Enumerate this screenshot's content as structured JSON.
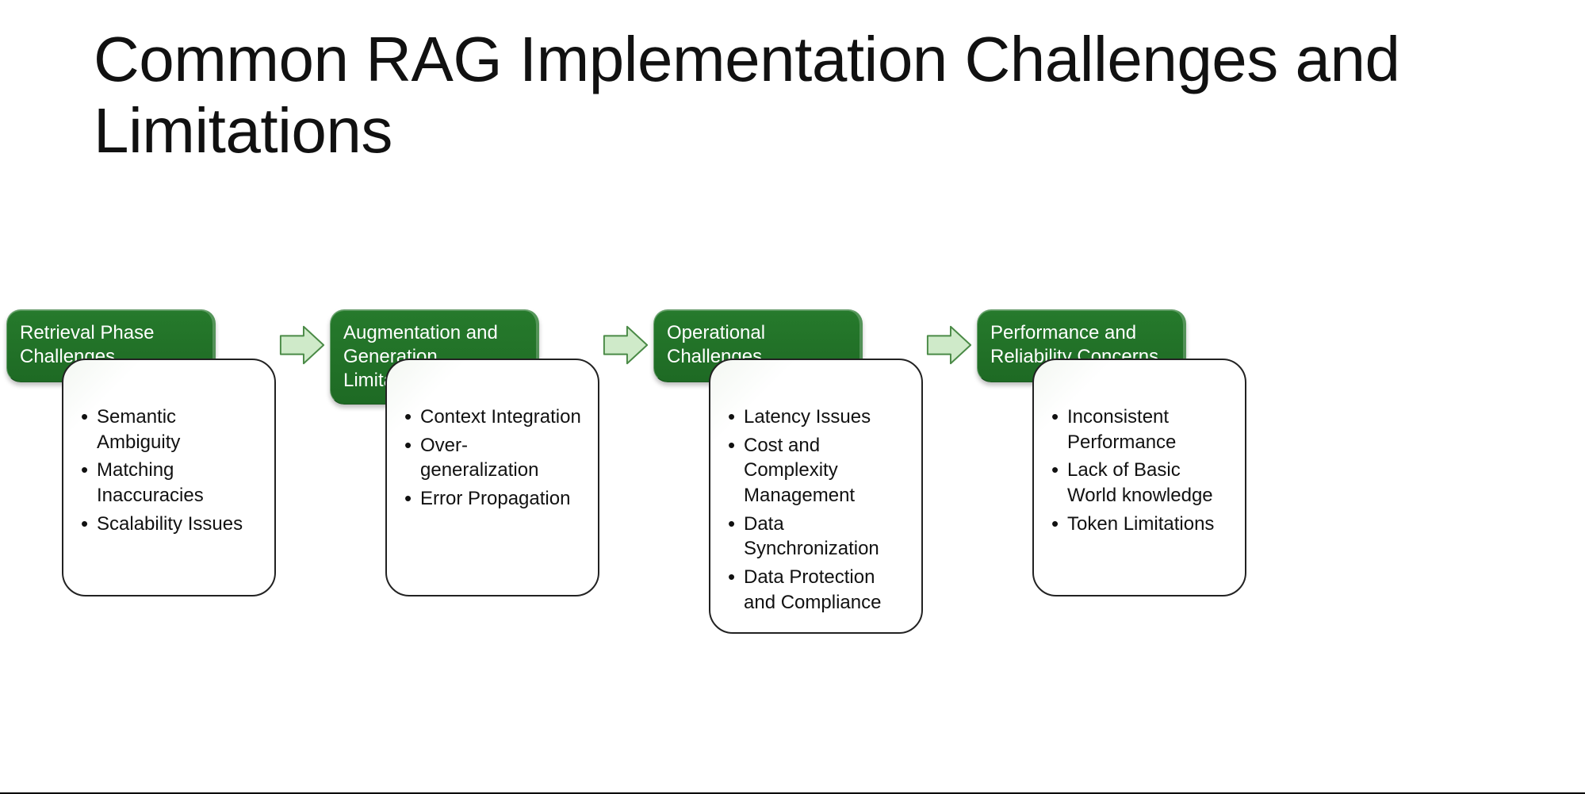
{
  "title": "Common RAG Implementation Challenges and Limitations",
  "groups": [
    {
      "header": "Retrieval Phase Challenges",
      "items": [
        "Semantic Ambiguity",
        "Matching Inaccuracies",
        "Scalability Issues"
      ]
    },
    {
      "header": "Augmentation and Generation Limitation",
      "items": [
        "Context Integration",
        "Over-generalization",
        "Error Propagation"
      ]
    },
    {
      "header": "Operational Challenges",
      "items": [
        "Latency Issues",
        "Cost and Complexity Management",
        "Data Synchronization",
        "Data Protection and Compliance"
      ]
    },
    {
      "header": "Performance and Reliability Concerns",
      "items": [
        "Inconsistent Performance",
        "Lack of Basic World knowledge",
        "Token Limitations"
      ]
    }
  ],
  "colors": {
    "header_bg": "#1f6e25",
    "arrow_fill": "#c9e9c3",
    "arrow_stroke": "#3d7a3a"
  }
}
